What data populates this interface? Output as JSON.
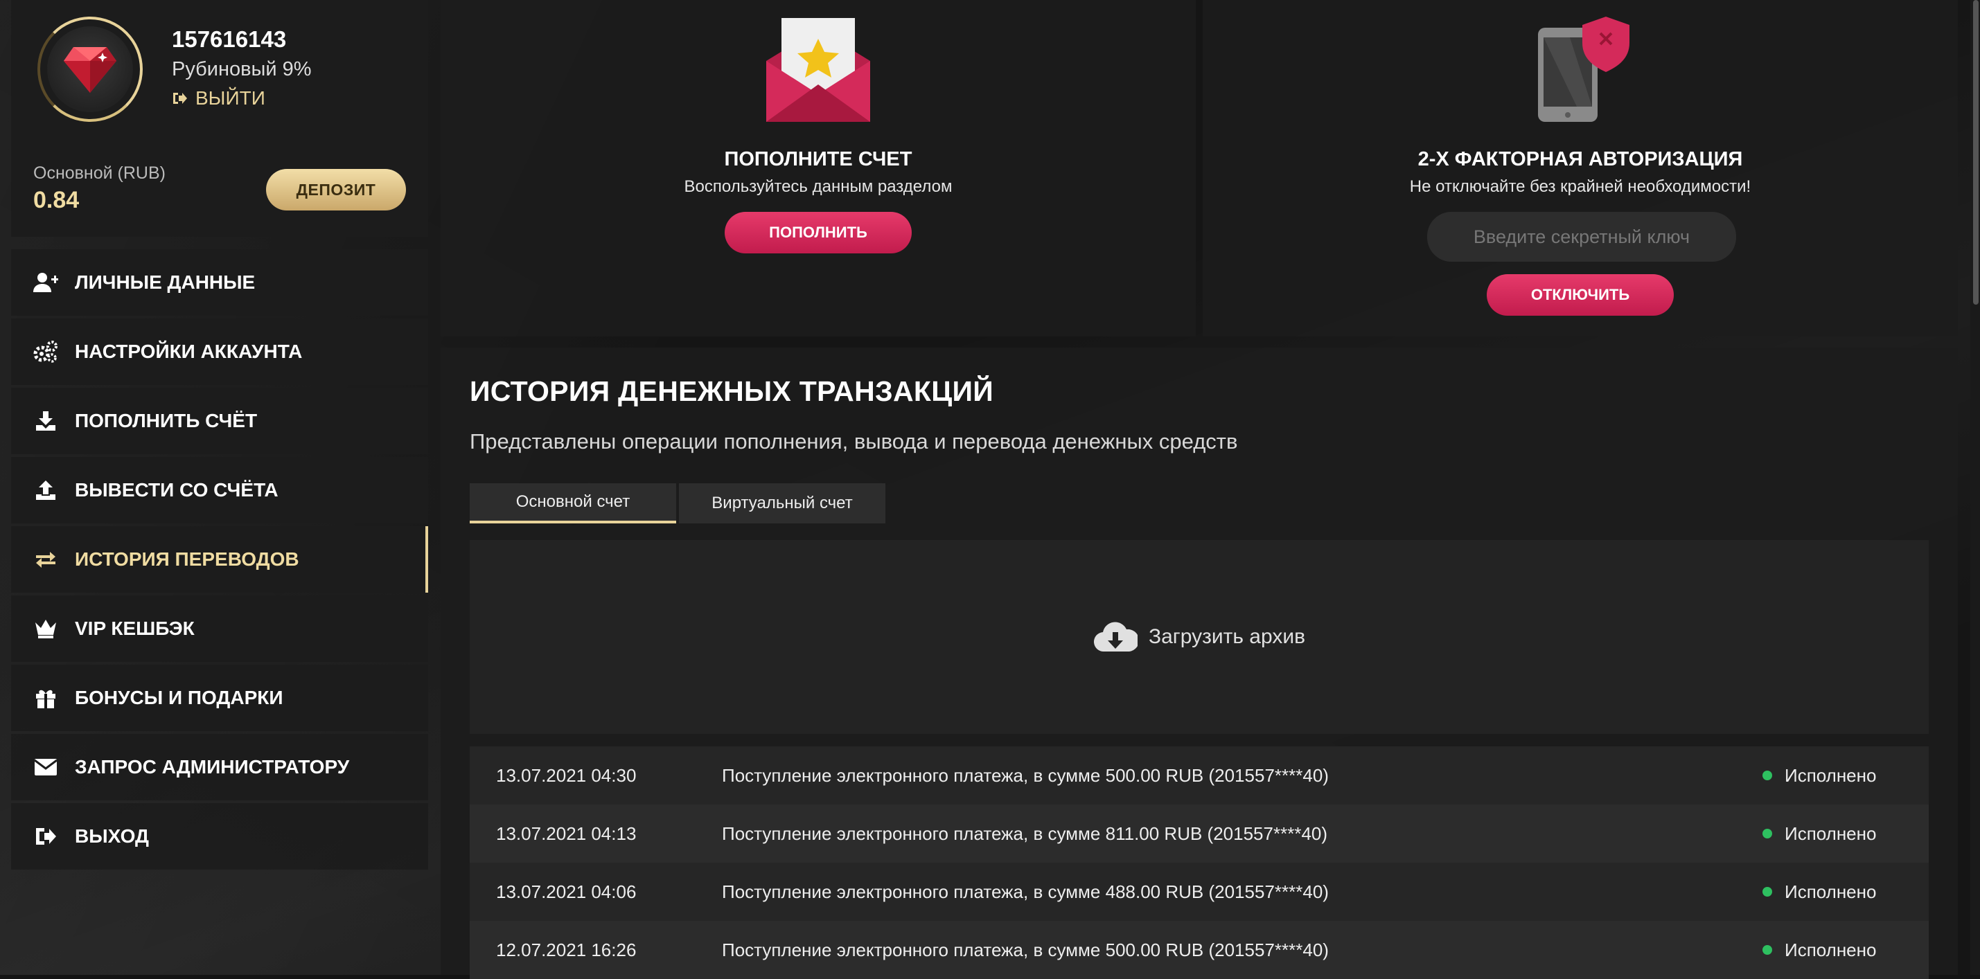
{
  "profile": {
    "user_id": "157616143",
    "level": "Рубиновый 9%",
    "logout_label": "ВЫЙТИ",
    "balance_label": "Основной (RUB)",
    "balance_value": "0.84",
    "deposit_label": "ДЕПОЗИТ"
  },
  "menu": {
    "items": [
      {
        "label": "ЛИЧНЫЕ ДАННЫЕ",
        "icon": "user-plus-icon"
      },
      {
        "label": "НАСТРОЙКИ АККАУНТА",
        "icon": "cogs-icon"
      },
      {
        "label": "ПОПОЛНИТЬ СЧЁТ",
        "icon": "download-icon"
      },
      {
        "label": "ВЫВЕСТИ СО СЧЁТА",
        "icon": "upload-icon"
      },
      {
        "label": "ИСТОРИЯ ПЕРЕВОДОВ",
        "icon": "exchange-icon",
        "active": true
      },
      {
        "label": "VIP КЕШБЭК",
        "icon": "crown-icon"
      },
      {
        "label": "БОНУСЫ И ПОДАРКИ",
        "icon": "gift-icon"
      },
      {
        "label": "ЗАПРОС АДМИНИСТРАТОРУ",
        "icon": "envelope-icon"
      },
      {
        "label": "ВЫХОД",
        "icon": "sign-out-icon"
      }
    ]
  },
  "deposit_card": {
    "title": "ПОПОЛНИТЕ СЧЕТ",
    "subtitle": "Воспользуйтесь данным разделом",
    "button_label": "ПОПОЛНИТЬ"
  },
  "twofa_card": {
    "title": "2-Х ФАКТОРНАЯ АВТОРИЗАЦИЯ",
    "subtitle": "Не отключайте без крайней необходимости!",
    "input_placeholder": "Введите секретный ключ",
    "button_label": "ОТКЛЮЧИТЬ"
  },
  "history": {
    "title": "ИСТОРИЯ ДЕНЕЖНЫХ ТРАНЗАКЦИЙ",
    "subtitle": "Представлены операции пополнения, вывода и перевода денежных средств",
    "tabs": [
      {
        "label": "Основной счет",
        "active": true
      },
      {
        "label": "Виртуальный счет",
        "active": false
      }
    ],
    "archive_label": "Загрузить архив",
    "rows": [
      {
        "date": "13.07.2021 04:30",
        "description": "Поступление электронного платежа, в сумме 500.00 RUB (201557****40)",
        "status": "Исполнено"
      },
      {
        "date": "13.07.2021 04:13",
        "description": "Поступление электронного платежа, в сумме 811.00 RUB (201557****40)",
        "status": "Исполнено"
      },
      {
        "date": "13.07.2021 04:06",
        "description": "Поступление электронного платежа, в сумме 488.00 RUB (201557****40)",
        "status": "Исполнено"
      },
      {
        "date": "12.07.2021 16:26",
        "description": "Поступление электронного платежа, в сумме 500.00 RUB (201557****40)",
        "status": "Исполнено"
      }
    ]
  },
  "colors": {
    "accent_gold": "#e8d39a",
    "accent_pink": "#d4265a",
    "status_ok": "#2ec060"
  }
}
